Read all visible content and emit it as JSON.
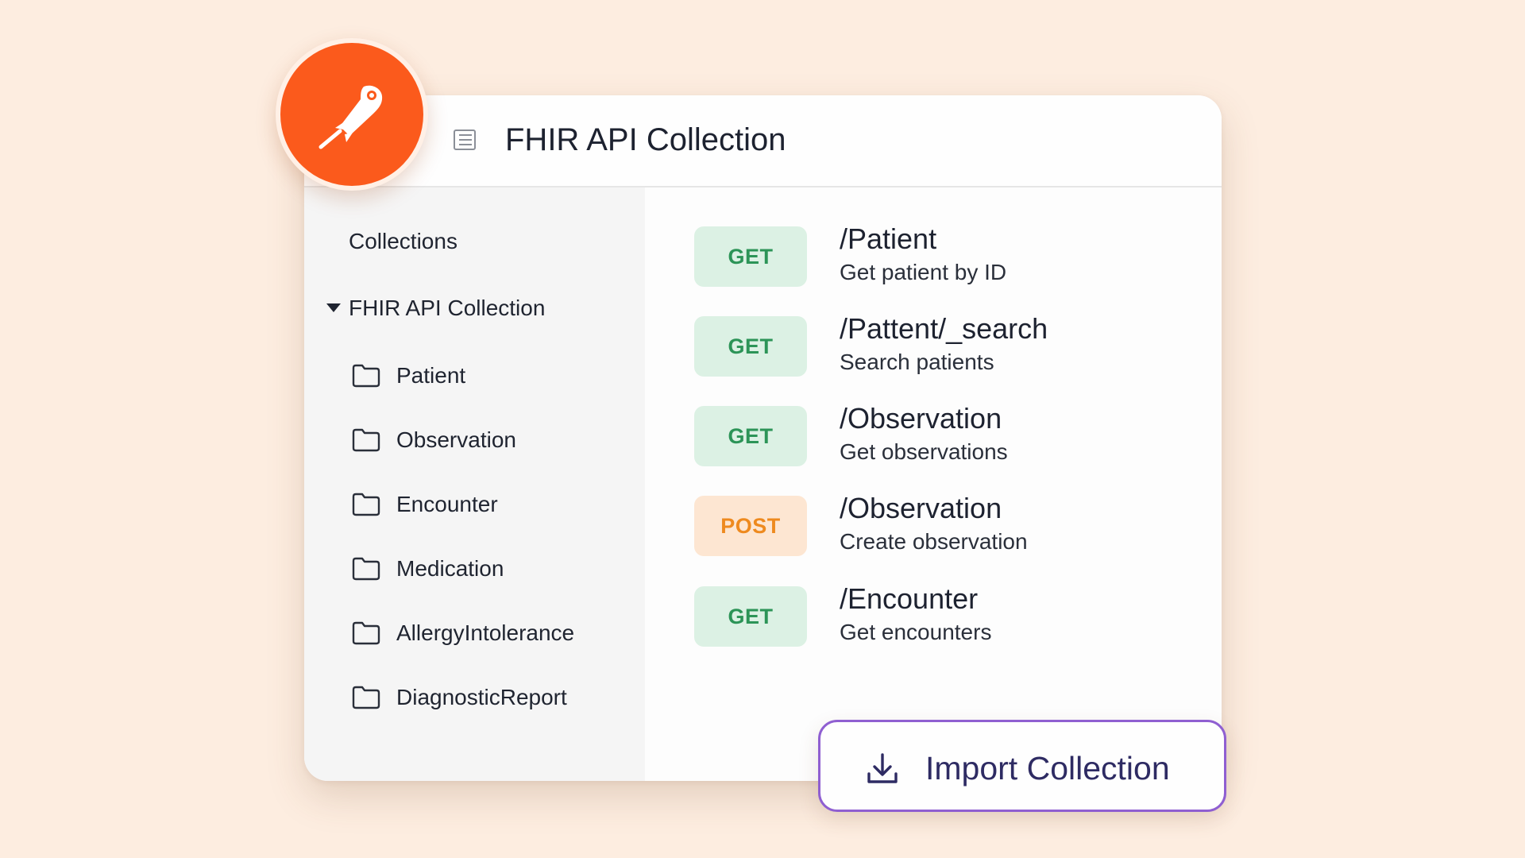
{
  "header": {
    "title": "FHIR API Collection",
    "menu_icon": "menu-lines-icon"
  },
  "logo": {
    "icon": "postman-astronaut-icon",
    "color": "#fb5a1c"
  },
  "sidebar": {
    "heading": "Collections",
    "collection": {
      "label": "FHIR API Collection",
      "expanded": true,
      "folders": [
        {
          "label": "Patient",
          "icon": "folder-icon"
        },
        {
          "label": "Observation",
          "icon": "folder-icon"
        },
        {
          "label": "Encounter",
          "icon": "folder-icon"
        },
        {
          "label": "Medication",
          "icon": "folder-icon"
        },
        {
          "label": "AllergyIntolerance",
          "icon": "folder-icon"
        },
        {
          "label": "DiagnosticReport",
          "icon": "folder-icon"
        }
      ]
    }
  },
  "endpoints": [
    {
      "method": "GET",
      "path": "/Patient",
      "description": "Get patient by ID"
    },
    {
      "method": "GET",
      "path": "/Pattent/_search",
      "description": "Search patients"
    },
    {
      "method": "GET",
      "path": "/Observation",
      "description": "Get observations"
    },
    {
      "method": "POST",
      "path": "/Observation",
      "description": "Create observation"
    },
    {
      "method": "GET",
      "path": "/Encounter",
      "description": "Get encounters"
    }
  ],
  "import_button": {
    "label": "Import Collection",
    "icon": "download-icon"
  },
  "colors": {
    "background": "#fdede0",
    "get_badge_bg": "#dcf1e4",
    "get_badge_text": "#2c9457",
    "post_badge_bg": "#fde6d2",
    "post_badge_text": "#ee8a1f",
    "import_border": "#8f5fd1",
    "import_text": "#2e2b63"
  }
}
